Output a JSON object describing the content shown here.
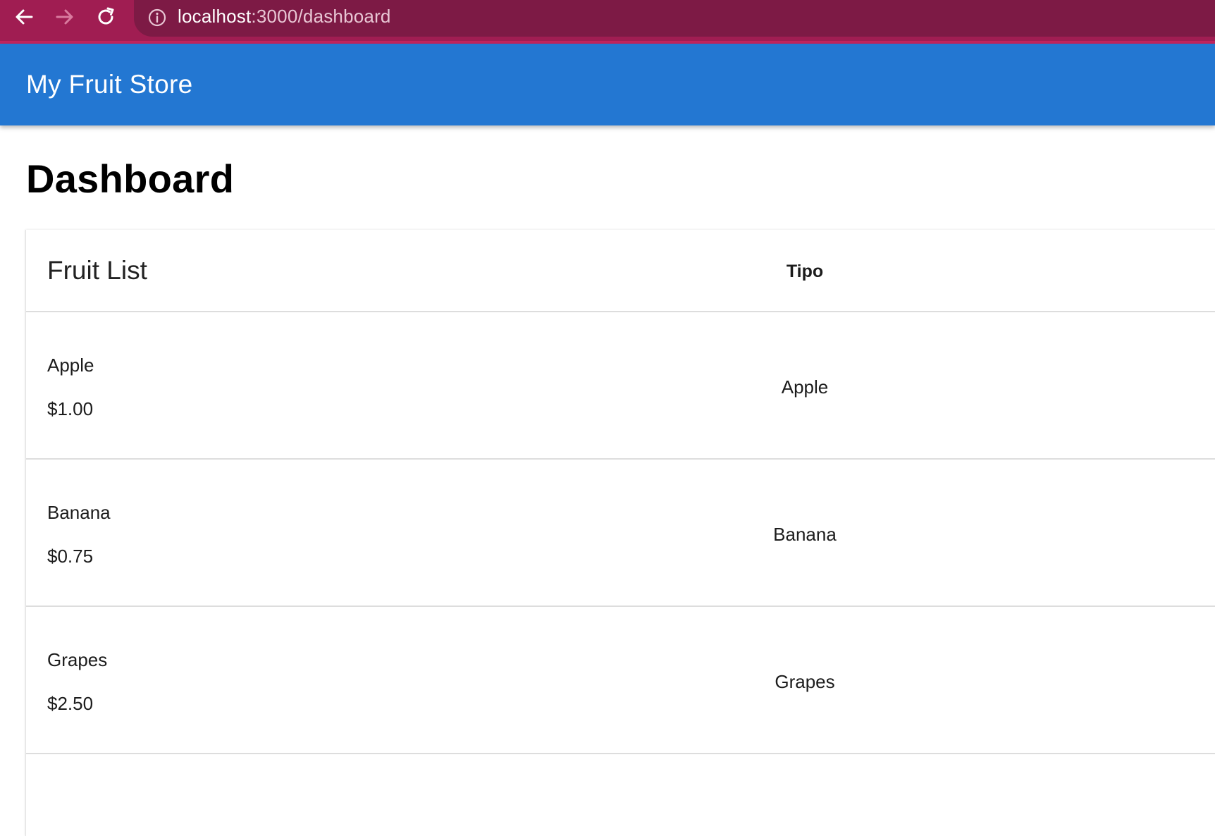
{
  "browser": {
    "url_host": "localhost",
    "url_path": ":3000/dashboard",
    "back_icon": "arrow-left-icon",
    "forward_icon": "arrow-right-icon",
    "reload_icon": "reload-icon",
    "site_info_icon": "info-circle-icon",
    "toolbar_color": "#a01d52",
    "omnibox_color": "#7d1a45"
  },
  "app_bar": {
    "title": "My Fruit Store",
    "color": "#2377d2"
  },
  "page": {
    "title": "Dashboard"
  },
  "fruit_card": {
    "title": "Fruit List",
    "column_header": "Tipo",
    "rows": [
      {
        "name": "Apple",
        "price": "$1.00",
        "type": "Apple"
      },
      {
        "name": "Banana",
        "price": "$0.75",
        "type": "Banana"
      },
      {
        "name": "Grapes",
        "price": "$2.50",
        "type": "Grapes"
      }
    ]
  }
}
